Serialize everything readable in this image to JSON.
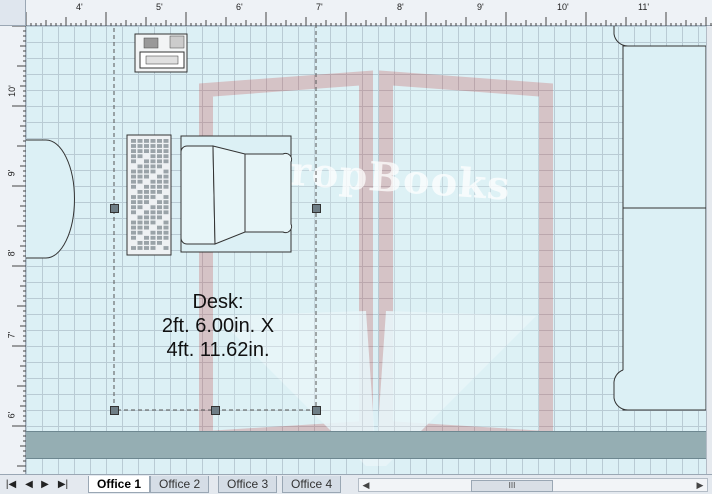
{
  "ruler": {
    "top_labels": [
      "4'",
      "5'",
      "6'",
      "7'",
      "8'",
      "9'",
      "10'",
      "11'"
    ],
    "left_labels": [
      "10'",
      "9'",
      "8'",
      "7'",
      "6'"
    ]
  },
  "shape": {
    "label_line1": "Desk:",
    "label_line2": "2ft. 6.00in. X",
    "label_line3": "4ft. 11.62in."
  },
  "watermark": {
    "text": "DropBooks"
  },
  "tabs": {
    "items": [
      {
        "label": "Office 1",
        "active": true
      },
      {
        "label": "Office 2",
        "active": false
      },
      {
        "label": "Office 3",
        "active": false
      },
      {
        "label": "Office 4",
        "active": false
      }
    ]
  },
  "nav": {
    "first": "|◀",
    "prev": "◀",
    "next": "▶",
    "last": "▶|"
  },
  "scroll": {
    "thumb_text": "III",
    "left_arrow": "◀",
    "right_arrow": "▶"
  },
  "colors": {
    "canvas": "#dcf0f5",
    "grid": "#b9cbd4",
    "wall": "#95aeb3",
    "watermark": "#c23a3a"
  },
  "icons": [
    "keyboard-icon",
    "chair-icon",
    "phone-icon",
    "selection-handle-icon"
  ]
}
